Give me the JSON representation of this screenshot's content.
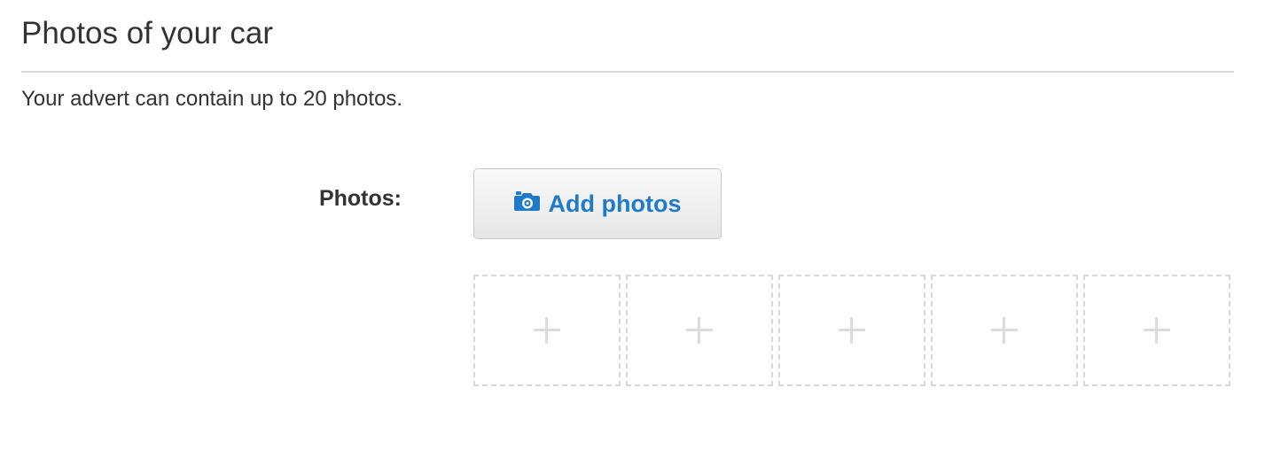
{
  "section": {
    "title": "Photos of your car",
    "intro": "Your advert can contain up to 20 photos."
  },
  "photos_field": {
    "label": "Photos:",
    "add_button": {
      "label": "Add photos",
      "icon": "camera-icon",
      "text_color": "#1f7ac9"
    },
    "slots": [
      {
        "icon": "plus-icon"
      },
      {
        "icon": "plus-icon"
      },
      {
        "icon": "plus-icon"
      },
      {
        "icon": "plus-icon"
      },
      {
        "icon": "plus-icon"
      }
    ]
  }
}
